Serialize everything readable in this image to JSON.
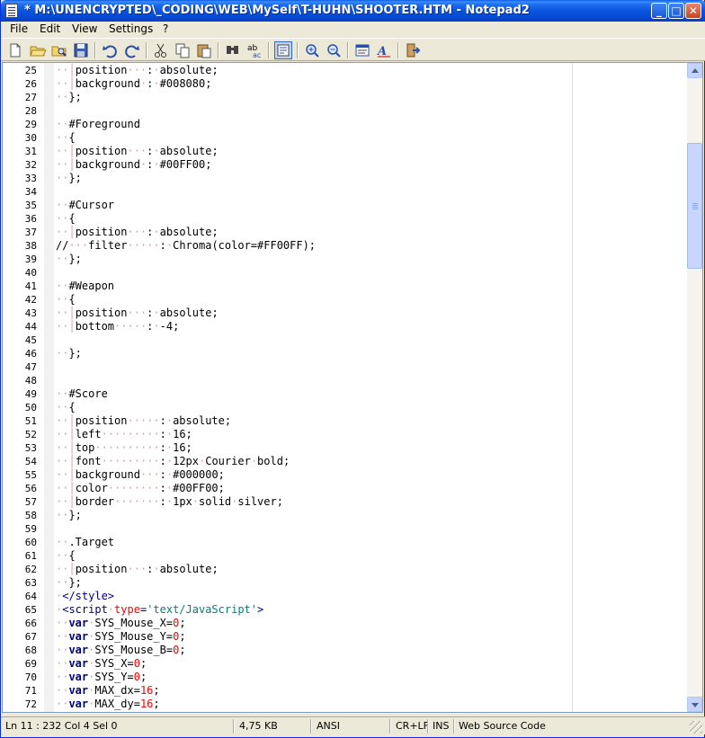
{
  "window": {
    "title": "* M:\\UNENCRYPTED\\_CODING\\WEB\\MySelf\\T-HUHN\\SHOOTER.HTM - Notepad2",
    "minimize": "_",
    "maximize": "□",
    "close": "✕"
  },
  "menu": [
    {
      "label": "File"
    },
    {
      "label": "Edit"
    },
    {
      "label": "View"
    },
    {
      "label": "Settings"
    },
    {
      "label": "?"
    }
  ],
  "toolbar": {
    "icons": [
      "new-file-icon",
      "open-folder-icon",
      "browse-icon",
      "save-icon",
      "undo-icon",
      "redo-icon",
      "cut-icon",
      "copy-icon",
      "paste-icon",
      "find-icon",
      "replace-icon",
      "word-wrap-icon",
      "zoom-in-icon",
      "zoom-out-icon",
      "scheme-icon",
      "font-icon",
      "exit-icon"
    ]
  },
  "code_lines": [
    {
      "n": "25",
      "segs": [
        [
          "ws",
          "··"
        ],
        [
          "ws",
          "│"
        ],
        [
          "",
          "position"
        ],
        [
          "ws",
          "···"
        ],
        [
          "",
          ":"
        ],
        [
          "ws",
          "·"
        ],
        [
          "",
          "absolute;"
        ]
      ]
    },
    {
      "n": "26",
      "segs": [
        [
          "ws",
          "··"
        ],
        [
          "ws",
          "│"
        ],
        [
          "",
          "background"
        ],
        [
          "ws",
          "·"
        ],
        [
          "",
          ":"
        ],
        [
          "ws",
          "·"
        ],
        [
          "",
          "#008080;"
        ]
      ]
    },
    {
      "n": "27",
      "segs": [
        [
          "ws",
          "··"
        ],
        [
          "",
          "};"
        ]
      ]
    },
    {
      "n": "28",
      "segs": []
    },
    {
      "n": "29",
      "segs": [
        [
          "ws",
          "··"
        ],
        [
          "",
          "#Foreground"
        ]
      ]
    },
    {
      "n": "30",
      "segs": [
        [
          "ws",
          "··"
        ],
        [
          "",
          "{"
        ]
      ]
    },
    {
      "n": "31",
      "segs": [
        [
          "ws",
          "··"
        ],
        [
          "ws",
          "│"
        ],
        [
          "",
          "position"
        ],
        [
          "ws",
          "···"
        ],
        [
          "",
          ":"
        ],
        [
          "ws",
          "·"
        ],
        [
          "",
          "absolute;"
        ]
      ]
    },
    {
      "n": "32",
      "segs": [
        [
          "ws",
          "··"
        ],
        [
          "ws",
          "│"
        ],
        [
          "",
          "background"
        ],
        [
          "ws",
          "·"
        ],
        [
          "",
          ":"
        ],
        [
          "ws",
          "·"
        ],
        [
          "",
          "#00FF00;"
        ]
      ]
    },
    {
      "n": "33",
      "segs": [
        [
          "ws",
          "··"
        ],
        [
          "",
          "};"
        ]
      ]
    },
    {
      "n": "34",
      "segs": []
    },
    {
      "n": "35",
      "segs": [
        [
          "ws",
          "··"
        ],
        [
          "",
          "#Cursor"
        ]
      ]
    },
    {
      "n": "36",
      "segs": [
        [
          "ws",
          "··"
        ],
        [
          "",
          "{"
        ]
      ]
    },
    {
      "n": "37",
      "segs": [
        [
          "ws",
          "··"
        ],
        [
          "ws",
          "│"
        ],
        [
          "",
          "position"
        ],
        [
          "ws",
          "···"
        ],
        [
          "",
          ":"
        ],
        [
          "ws",
          "·"
        ],
        [
          "",
          "absolute;"
        ]
      ]
    },
    {
      "n": "38",
      "segs": [
        [
          "",
          "//"
        ],
        [
          "ws",
          "···"
        ],
        [
          "",
          "filter"
        ],
        [
          "ws",
          "·····"
        ],
        [
          "",
          ":"
        ],
        [
          "ws",
          "·"
        ],
        [
          "",
          "Chroma(color=#FF00FF);"
        ]
      ]
    },
    {
      "n": "39",
      "segs": [
        [
          "ws",
          "··"
        ],
        [
          "",
          "};"
        ]
      ]
    },
    {
      "n": "40",
      "segs": []
    },
    {
      "n": "41",
      "segs": [
        [
          "ws",
          "··"
        ],
        [
          "",
          "#Weapon"
        ]
      ]
    },
    {
      "n": "42",
      "segs": [
        [
          "ws",
          "··"
        ],
        [
          "",
          "{"
        ]
      ]
    },
    {
      "n": "43",
      "segs": [
        [
          "ws",
          "··"
        ],
        [
          "ws",
          "│"
        ],
        [
          "",
          "position"
        ],
        [
          "ws",
          "···"
        ],
        [
          "",
          ":"
        ],
        [
          "ws",
          "·"
        ],
        [
          "",
          "absolute;"
        ]
      ]
    },
    {
      "n": "44",
      "segs": [
        [
          "ws",
          "··"
        ],
        [
          "ws",
          "│"
        ],
        [
          "",
          "bottom"
        ],
        [
          "ws",
          "·····"
        ],
        [
          "",
          ":"
        ],
        [
          "ws",
          "·"
        ],
        [
          "",
          "-4;"
        ]
      ]
    },
    {
      "n": "45",
      "segs": []
    },
    {
      "n": "46",
      "segs": [
        [
          "ws",
          "··"
        ],
        [
          "",
          "};"
        ]
      ]
    },
    {
      "n": "47",
      "segs": []
    },
    {
      "n": "48",
      "segs": []
    },
    {
      "n": "49",
      "segs": [
        [
          "ws",
          "··"
        ],
        [
          "",
          "#Score"
        ]
      ]
    },
    {
      "n": "50",
      "segs": [
        [
          "ws",
          "··"
        ],
        [
          "",
          "{"
        ]
      ]
    },
    {
      "n": "51",
      "segs": [
        [
          "ws",
          "··"
        ],
        [
          "ws",
          "│"
        ],
        [
          "",
          "position"
        ],
        [
          "ws",
          "·····"
        ],
        [
          "",
          ":"
        ],
        [
          "ws",
          "·"
        ],
        [
          "",
          "absolute;"
        ]
      ]
    },
    {
      "n": "52",
      "segs": [
        [
          "ws",
          "··"
        ],
        [
          "ws",
          "│"
        ],
        [
          "",
          "left"
        ],
        [
          "ws",
          "·········"
        ],
        [
          "",
          ":"
        ],
        [
          "ws",
          "·"
        ],
        [
          "",
          "16;"
        ]
      ]
    },
    {
      "n": "53",
      "segs": [
        [
          "ws",
          "··"
        ],
        [
          "ws",
          "│"
        ],
        [
          "",
          "top"
        ],
        [
          "ws",
          "··········"
        ],
        [
          "",
          ":"
        ],
        [
          "ws",
          "·"
        ],
        [
          "",
          "16;"
        ]
      ]
    },
    {
      "n": "54",
      "segs": [
        [
          "ws",
          "··"
        ],
        [
          "ws",
          "│"
        ],
        [
          "",
          "font"
        ],
        [
          "ws",
          "·········"
        ],
        [
          "",
          ":"
        ],
        [
          "ws",
          "·"
        ],
        [
          "",
          "12px"
        ],
        [
          "ws",
          "·"
        ],
        [
          "",
          "Courier"
        ],
        [
          "ws",
          "·"
        ],
        [
          "",
          "bold;"
        ]
      ]
    },
    {
      "n": "55",
      "segs": [
        [
          "ws",
          "··"
        ],
        [
          "ws",
          "│"
        ],
        [
          "",
          "background"
        ],
        [
          "ws",
          "···"
        ],
        [
          "",
          ":"
        ],
        [
          "ws",
          "·"
        ],
        [
          "",
          "#000000;"
        ]
      ]
    },
    {
      "n": "56",
      "segs": [
        [
          "ws",
          "··"
        ],
        [
          "ws",
          "│"
        ],
        [
          "",
          "color"
        ],
        [
          "ws",
          "········"
        ],
        [
          "",
          ":"
        ],
        [
          "ws",
          "·"
        ],
        [
          "",
          "#00FF00;"
        ]
      ]
    },
    {
      "n": "57",
      "segs": [
        [
          "ws",
          "··"
        ],
        [
          "ws",
          "│"
        ],
        [
          "",
          "border"
        ],
        [
          "ws",
          "·······"
        ],
        [
          "",
          ":"
        ],
        [
          "ws",
          "·"
        ],
        [
          "",
          "1px"
        ],
        [
          "ws",
          "·"
        ],
        [
          "",
          "solid"
        ],
        [
          "ws",
          "·"
        ],
        [
          "",
          "silver;"
        ]
      ]
    },
    {
      "n": "58",
      "segs": [
        [
          "ws",
          "··"
        ],
        [
          "",
          "};"
        ]
      ]
    },
    {
      "n": "59",
      "segs": []
    },
    {
      "n": "60",
      "segs": [
        [
          "ws",
          "··"
        ],
        [
          "",
          ".Target"
        ]
      ]
    },
    {
      "n": "61",
      "segs": [
        [
          "ws",
          "··"
        ],
        [
          "",
          "{"
        ]
      ]
    },
    {
      "n": "62",
      "segs": [
        [
          "ws",
          "··"
        ],
        [
          "ws",
          "│"
        ],
        [
          "",
          "position"
        ],
        [
          "ws",
          "···"
        ],
        [
          "",
          ":"
        ],
        [
          "ws",
          "·"
        ],
        [
          "",
          "absolute;"
        ]
      ]
    },
    {
      "n": "63",
      "segs": [
        [
          "ws",
          "··"
        ],
        [
          "",
          "};"
        ]
      ]
    },
    {
      "n": "64",
      "segs": [
        [
          "ws",
          "·"
        ],
        [
          "tg",
          "</style>"
        ]
      ]
    },
    {
      "n": "65",
      "segs": [
        [
          "ws",
          "·"
        ],
        [
          "tg",
          "<script"
        ],
        [
          "ws",
          "·"
        ],
        [
          "at",
          "type"
        ],
        [
          "tg",
          "="
        ],
        [
          "st",
          "'text/JavaScript'"
        ],
        [
          "tg",
          ">"
        ]
      ]
    },
    {
      "n": "66",
      "segs": [
        [
          "ws",
          "··"
        ],
        [
          "kw",
          "var"
        ],
        [
          "ws",
          "·"
        ],
        [
          "",
          "SYS_Mouse_X="
        ],
        [
          "nm",
          "0"
        ],
        [
          "",
          ";"
        ]
      ]
    },
    {
      "n": "67",
      "segs": [
        [
          "ws",
          "··"
        ],
        [
          "kw",
          "var"
        ],
        [
          "ws",
          "·"
        ],
        [
          "",
          "SYS_Mouse_Y="
        ],
        [
          "nm",
          "0"
        ],
        [
          "",
          ";"
        ]
      ]
    },
    {
      "n": "68",
      "segs": [
        [
          "ws",
          "··"
        ],
        [
          "kw",
          "var"
        ],
        [
          "ws",
          "·"
        ],
        [
          "",
          "SYS_Mouse_B="
        ],
        [
          "nm",
          "0"
        ],
        [
          "",
          ";"
        ]
      ]
    },
    {
      "n": "69",
      "segs": [
        [
          "ws",
          "··"
        ],
        [
          "kw",
          "var"
        ],
        [
          "ws",
          "·"
        ],
        [
          "",
          "SYS_X="
        ],
        [
          "nm",
          "0"
        ],
        [
          "",
          ";"
        ]
      ]
    },
    {
      "n": "70",
      "segs": [
        [
          "ws",
          "··"
        ],
        [
          "kw",
          "var"
        ],
        [
          "ws",
          "·"
        ],
        [
          "",
          "SYS_Y="
        ],
        [
          "nm",
          "0"
        ],
        [
          "",
          ";"
        ]
      ]
    },
    {
      "n": "71",
      "segs": [
        [
          "ws",
          "··"
        ],
        [
          "kw",
          "var"
        ],
        [
          "ws",
          "·"
        ],
        [
          "",
          "MAX_dx="
        ],
        [
          "nm",
          "16"
        ],
        [
          "",
          ";"
        ]
      ]
    },
    {
      "n": "72",
      "segs": [
        [
          "ws",
          "··"
        ],
        [
          "kw",
          "var"
        ],
        [
          "ws",
          "·"
        ],
        [
          "",
          "MAX_dy="
        ],
        [
          "nm",
          "16"
        ],
        [
          "",
          ";"
        ]
      ]
    }
  ],
  "status": {
    "position": "Ln 11 : 232   Col 4   Sel 0",
    "size": "4,75 KB",
    "encoding": "ANSI",
    "line_ending": "CR+LF",
    "mode": "INS",
    "lexer": "Web Source Code"
  }
}
